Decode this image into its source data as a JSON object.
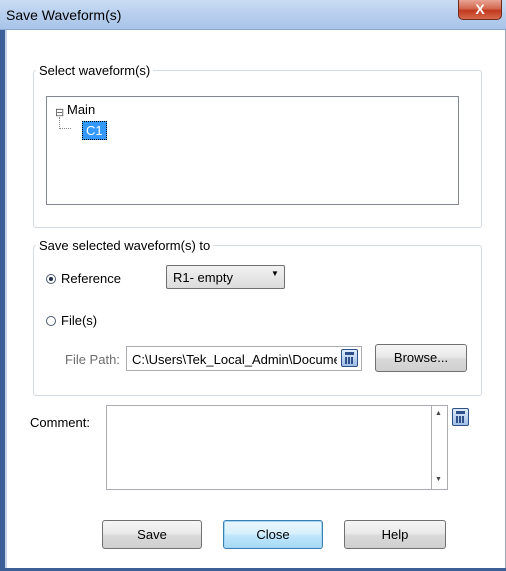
{
  "window": {
    "title": "Save Waveform(s)",
    "close_glyph": "X"
  },
  "select_group": {
    "legend": "Select waveform(s)",
    "tree": {
      "expand_glyph": "⊟",
      "root": "Main",
      "child": "C1"
    }
  },
  "save_group": {
    "legend": "Save selected waveform(s) to",
    "reference_label": "Reference",
    "reference_selected": true,
    "reference_combo": "R1- empty",
    "files_label": "File(s)",
    "files_selected": false,
    "file_path_label": "File Path:",
    "file_path_value": "C:\\Users\\Tek_Local_Admin\\Documents",
    "browse_label": "Browse..."
  },
  "comment": {
    "label": "Comment:",
    "value": ""
  },
  "buttons": {
    "save": "Save",
    "close": "Close",
    "help": "Help"
  },
  "icons": {
    "combo_arrow": "▼",
    "scroll_up": "▲",
    "scroll_down": "▼"
  }
}
